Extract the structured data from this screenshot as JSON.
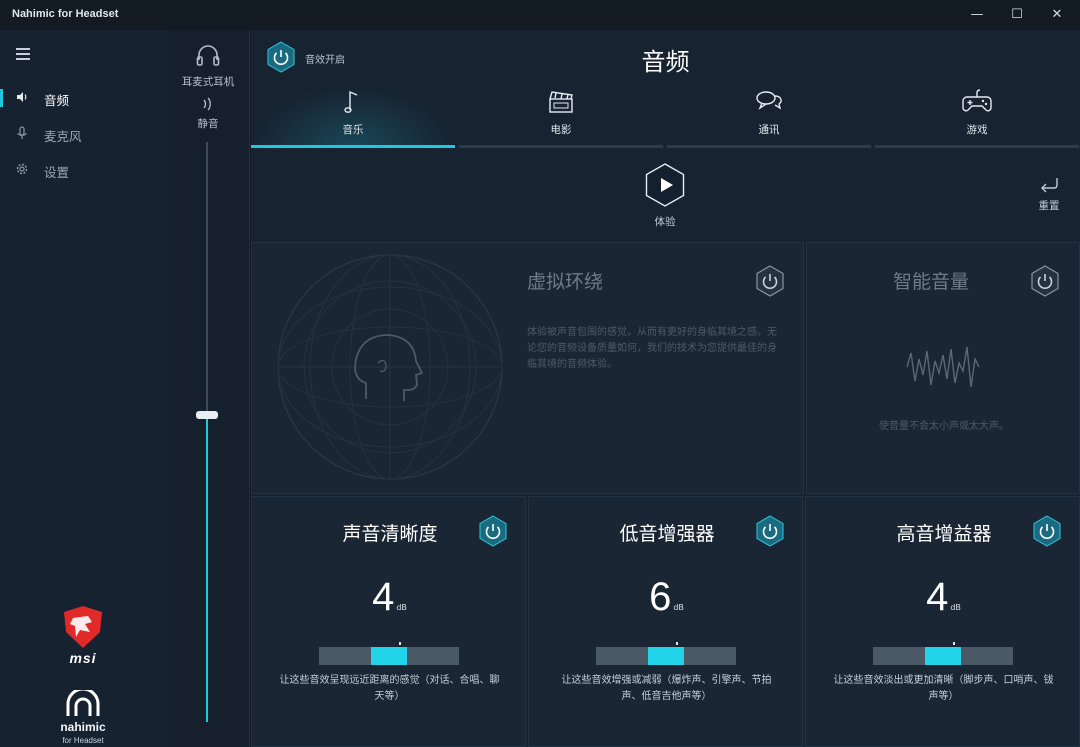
{
  "window": {
    "title": "Nahimic for Headset",
    "controls": {
      "minimize": "—",
      "maximize": "☐",
      "close": "✕"
    }
  },
  "sidebar": {
    "items": [
      {
        "label": "音频",
        "icon": "speaker-icon",
        "active": true
      },
      {
        "label": "麦克风",
        "icon": "microphone-icon",
        "active": false
      },
      {
        "label": "设置",
        "icon": "gear-icon",
        "active": false
      }
    ],
    "brand_msi": "msi",
    "brand_nahimic": "nahimic",
    "brand_nahimic_sub": "for Headset"
  },
  "device": {
    "headphone_label": "耳麦式耳机",
    "mute_label": "静音",
    "volume_level": 0.53
  },
  "header": {
    "effects_label": "音效开启",
    "title": "音频"
  },
  "tabs": [
    {
      "label": "音乐",
      "icon": "music-note-icon",
      "active": true
    },
    {
      "label": "电影",
      "icon": "clapperboard-icon",
      "active": false
    },
    {
      "label": "通讯",
      "icon": "chat-icon",
      "active": false
    },
    {
      "label": "游戏",
      "icon": "gamepad-icon",
      "active": false
    }
  ],
  "actions": {
    "experience_label": "体验",
    "reset_label": "重置"
  },
  "virtual_surround": {
    "title": "虚拟环绕",
    "description": "体验被声音包围的感觉，从而有更好的身临其境之感。无论您的音频设备质量如何，我们的技术为您提供最佳的身临其境的音频体验。"
  },
  "smart_volume": {
    "title": "智能音量",
    "description": "使音量不会太小声或太大声。"
  },
  "cards": [
    {
      "title": "声音清晰度",
      "value": "4",
      "unit": "dB",
      "level": 0.5,
      "description": "让这些音效呈现远近距离的感觉（对话、合唱、聊天等）"
    },
    {
      "title": "低音增强器",
      "value": "6",
      "unit": "dB",
      "level": 0.5,
      "description": "让这些音效增强或减弱（爆炸声、引擎声、节拍声、低音吉他声等）"
    },
    {
      "title": "高音增益器",
      "value": "4",
      "unit": "dB",
      "level": 0.5,
      "description": "让这些音效淡出或更加清晰（脚步声、口哨声、钹声等）"
    }
  ],
  "colors": {
    "accent": "#1ec9e0",
    "background": "#111a24",
    "panel": "#1a2634"
  }
}
